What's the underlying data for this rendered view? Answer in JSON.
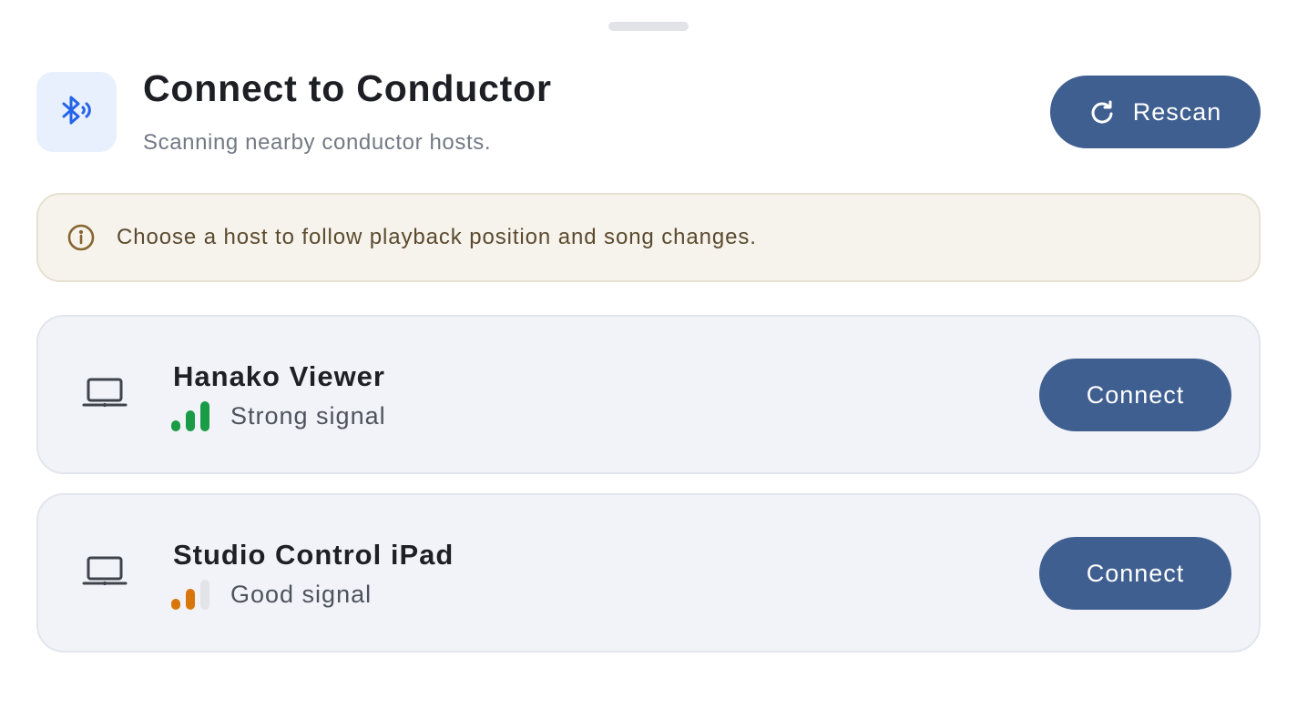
{
  "header": {
    "title": "Connect to Conductor",
    "subtitle": "Scanning nearby conductor hosts.",
    "icon": "bluetooth-searching-icon",
    "rescan_label": "Rescan",
    "rescan_icon": "refresh-icon"
  },
  "banner": {
    "icon": "info-icon",
    "text": "Choose a host to follow playback position and song changes."
  },
  "hosts": [
    {
      "name": "Hanako Viewer",
      "device_icon": "laptop-icon",
      "signal_label": "Strong signal",
      "signal_bars_active": 3,
      "signal_bars_total": 3,
      "signal_color": "#1a9b45",
      "connect_label": "Connect"
    },
    {
      "name": "Studio Control iPad",
      "device_icon": "laptop-icon",
      "signal_label": "Good signal",
      "signal_bars_active": 2,
      "signal_bars_total": 3,
      "signal_color": "#d9760b",
      "connect_label": "Connect"
    }
  ],
  "colors": {
    "accent": "#3f5f90",
    "bluetooth_icon": "#2563eb",
    "banner_bg": "#f6f3ec",
    "card_bg": "#f2f3f8",
    "inactive_bar": "#e2e4e8"
  }
}
